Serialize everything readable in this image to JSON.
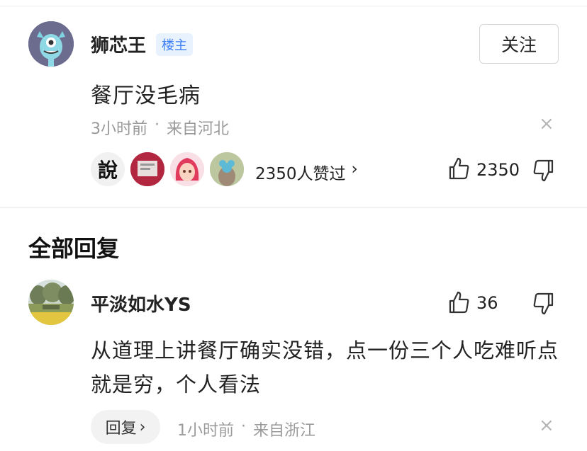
{
  "post": {
    "author_name": "狮芯王",
    "author_badge": "楼主",
    "follow_label": "关注",
    "content": "餐厅没毛病",
    "time": "3小时前",
    "location": "来自河北",
    "separator": "·",
    "likers_text": "2350人赞过",
    "likers_chevron": "›",
    "like_count": "2350",
    "liker_avatar_1_text": "說",
    "close_glyph": "×"
  },
  "replies_section": {
    "title": "全部回复"
  },
  "reply": {
    "author_name": "平淡如水YS",
    "like_count": "36",
    "content": "从道理上讲餐厅确实没错，点一份三个人吃难听点就是穷，个人看法",
    "reply_label": "回复",
    "reply_chevron": "›",
    "time": "1小时前",
    "location": "来自浙江",
    "separator": "·",
    "close_glyph": "×"
  },
  "icons": [
    "monster-avatar-icon",
    "thumbs-up-icon",
    "thumbs-down-icon",
    "close-icon",
    "chevron-right-icon"
  ],
  "colors": {
    "badge_bg": "#e8f2ff",
    "badge_text": "#3d7ff5",
    "meta_text": "#9a9a9a"
  }
}
